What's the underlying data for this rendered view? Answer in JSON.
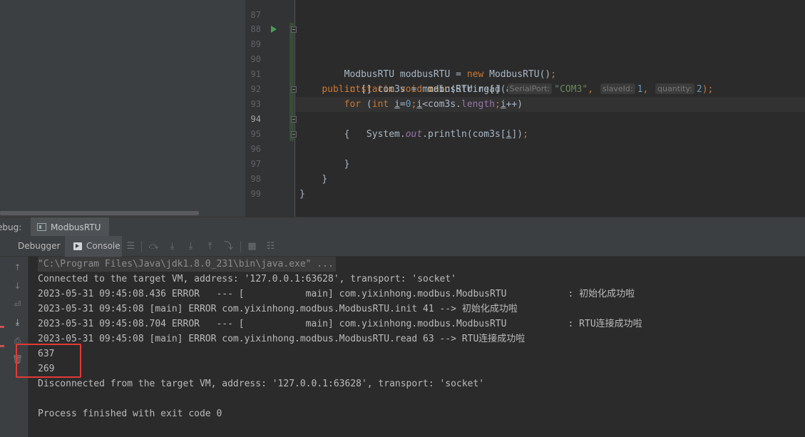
{
  "editor": {
    "lines": [
      {
        "num": "87"
      },
      {
        "num": "88"
      },
      {
        "num": "89"
      },
      {
        "num": "90"
      },
      {
        "num": "91"
      },
      {
        "num": "92"
      },
      {
        "num": "93"
      },
      {
        "num": "94"
      },
      {
        "num": "95"
      },
      {
        "num": "96"
      },
      {
        "num": "97"
      },
      {
        "num": "98"
      },
      {
        "num": "99"
      }
    ],
    "code": {
      "l89": {
        "kw": "public static void ",
        "fn": "main",
        "rest": "(String[] args) {"
      },
      "l90": {
        "a": "ModbusRTU modbusRTU = ",
        "kw": "new",
        "b": " ModbusRTU()",
        "semi": ";"
      },
      "l91": {
        "kw": "int",
        "a": "[] com3s = modbusRTU.read(",
        "hint1": "SerialPort:",
        "str": "\"COM3\"",
        "comma1": ",",
        "hint2": "slaveId:",
        "num1": "1",
        "comma2": ",",
        "hint3": "quantity:",
        "num2": "2",
        "end": ");"
      },
      "l92": {
        "kw": "for",
        "a": " (",
        "kw2": "int ",
        "var1": "i",
        "eq": "=",
        "num": "0",
        "semi1": ";",
        "var2": "i",
        "lt": "<com3s.",
        "fld": "length",
        "semi2": ";",
        "var3": "i",
        "end": "++)"
      },
      "l93": {
        "brace": "{"
      },
      "l94": {
        "a": "System.",
        "out": "out",
        "b": ".println(com3s[",
        "var": "i",
        "c": "])",
        "semi": ";"
      },
      "l95": {
        "brace": "}"
      },
      "l96": {
        "brace": "}"
      },
      "l98": {
        "brace": "}"
      }
    }
  },
  "debug": {
    "label": "ebug:",
    "session_tab": "ModbusRTU",
    "tabs": {
      "debugger": "Debugger",
      "console": "Console"
    }
  },
  "console": {
    "lines": [
      "\"C:\\Program Files\\Java\\jdk1.8.0_231\\bin\\java.exe\" ...",
      "Connected to the target VM, address: '127.0.0.1:63628', transport: 'socket'",
      "2023-05-31 09:45:08.436 ERROR   --- [           main] com.yixinhong.modbus.ModbusRTU           : 初始化成功啦",
      "2023-05-31 09:45:08 [main] ERROR com.yixinhong.modbus.ModbusRTU.init 41 --> 初始化成功啦",
      "2023-05-31 09:45:08.704 ERROR   --- [           main] com.yixinhong.modbus.ModbusRTU           : RTU连接成功啦",
      "2023-05-31 09:45:08 [main] ERROR com.yixinhong.modbus.ModbusRTU.read 63 --> RTU连接成功啦",
      "637",
      "269",
      "Disconnected from the target VM, address: '127.0.0.1:63628', transport: 'socket'",
      "",
      "Process finished with exit code 0"
    ]
  },
  "colors": {
    "keyword": "#cc7832",
    "function": "#ffc66d",
    "string": "#6a8759",
    "number": "#6897bb",
    "field": "#9876aa",
    "highlight_box": "#e53935",
    "run_icon": "#499c54"
  },
  "icons": {
    "run": "run-gutter-icon",
    "fold": "fold-icon",
    "console": "console-icon",
    "session": "session-icon"
  }
}
